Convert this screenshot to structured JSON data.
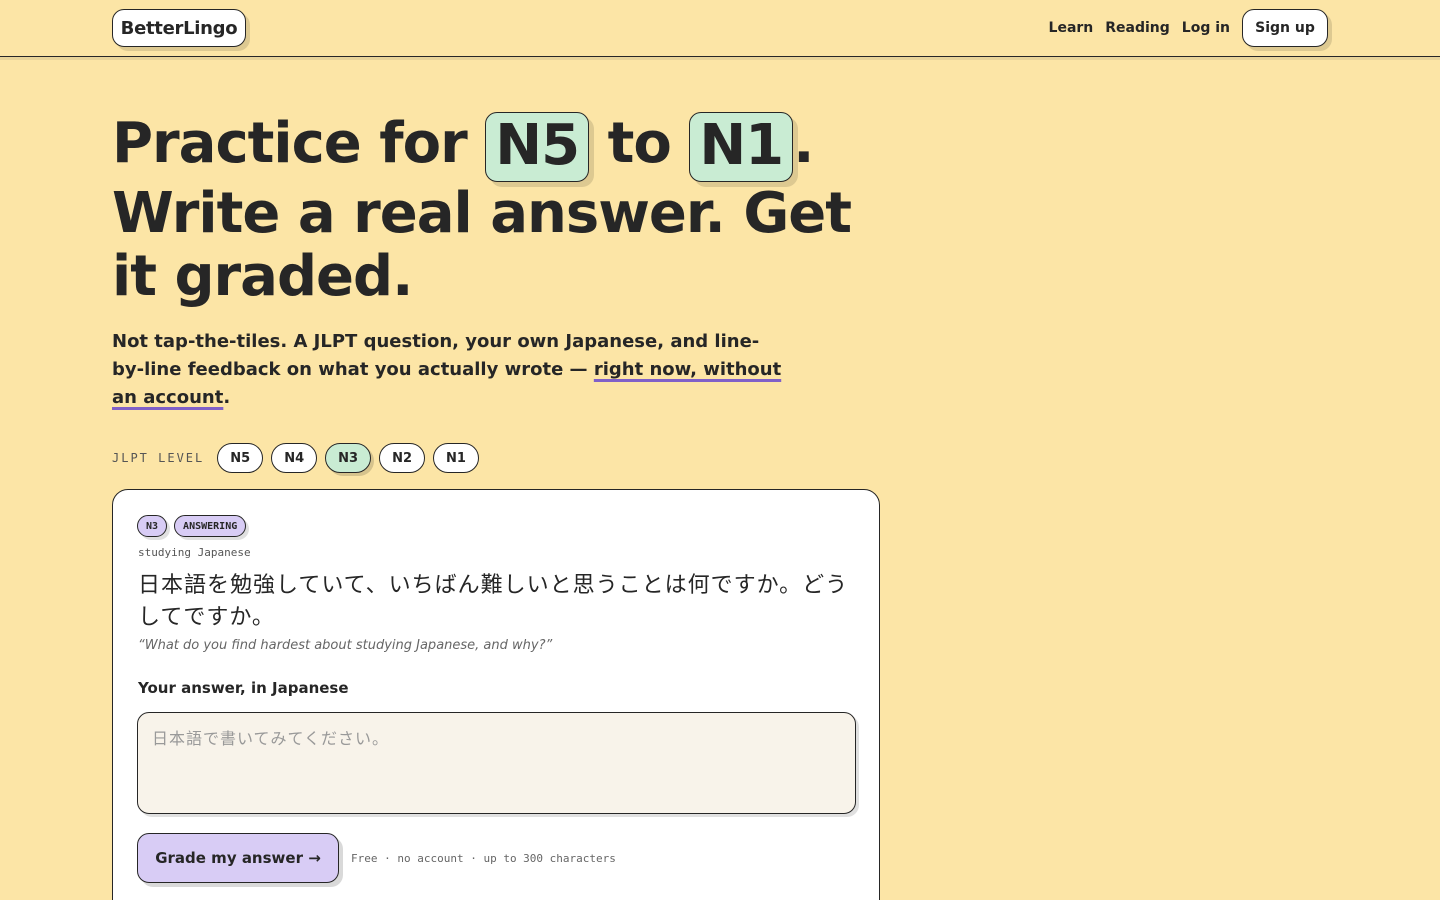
{
  "header": {
    "logo": "BetterLingo",
    "nav": [
      {
        "label": "Learn"
      },
      {
        "label": "Reading"
      },
      {
        "label": "Log in"
      }
    ],
    "signup_label": "Sign up"
  },
  "hero": {
    "title_part1": "Practice for ",
    "level_from": "N5",
    "title_part2": " to ",
    "level_to": "N1",
    "title_part3": ".",
    "title_line2": "Write a real answer. Get it graded.",
    "sub_text": "Not tap-the-tiles. A JLPT question, your own Japanese, and line-by-line feedback on what you actually wrote — ",
    "sub_highlight": "right now, without an account",
    "sub_end": "."
  },
  "levels": {
    "label": "JLPT LEVEL",
    "options": [
      "N5",
      "N4",
      "N3",
      "N2",
      "N1"
    ],
    "selected": "N3"
  },
  "card": {
    "tag_level": "N3",
    "tag_status": "ANSWERING",
    "topic": "studying Japanese",
    "question": "日本語を勉強していて、いちばん難しいと思うことは何ですか。どうしてですか。",
    "translation": "“What do you find hardest about studying Japanese, and why?”",
    "answer_label": "Your answer, in Japanese",
    "answer_placeholder": "日本語で書いてみてください。",
    "answer_value": "",
    "grade_label": "Grade my answer →",
    "note": "Free · no account · up to 300 characters"
  },
  "colors": {
    "background": "#fce5a6",
    "level_highlight": "#c9ecd3",
    "accent_purple": "#d8ccf5",
    "underline": "#8060c8"
  }
}
